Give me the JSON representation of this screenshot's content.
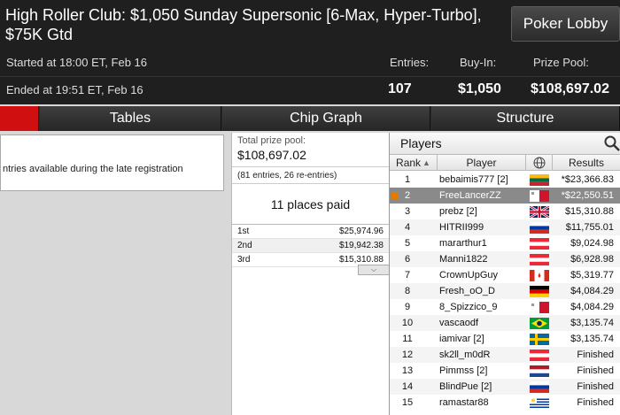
{
  "header": {
    "title": "High Roller Club: $1,050 Sunday Supersonic [6-Max, Hyper-Turbo], $75K Gtd",
    "lobby_button": "Poker Lobby",
    "started": "Started at 18:00 ET, Feb 16",
    "ended": "Ended at 19:51 ET, Feb 16",
    "entries_label": "Entries:",
    "entries_value": "107",
    "buyin_label": "Buy-In:",
    "buyin_value": "$1,050",
    "prize_label": "Prize Pool:",
    "prize_value": "$108,697.02"
  },
  "tabs": [
    "Tables",
    "Chip Graph",
    "Structure"
  ],
  "left_panel": {
    "note": "ntries available during the late registration"
  },
  "prize_panel": {
    "total_label": "Total prize pool:",
    "total_value": "$108,697.02",
    "entries_note": "(81 entries, 26 re-entries)",
    "places_paid": "11 places paid",
    "payouts": [
      {
        "place": "1st",
        "amount": "$25,974.96"
      },
      {
        "place": "2nd",
        "amount": "$19,942.38"
      },
      {
        "place": "3rd",
        "amount": "$15,310.88"
      }
    ]
  },
  "players": {
    "title": "Players",
    "columns": {
      "rank": "Rank",
      "player": "Player",
      "results": "Results"
    },
    "rows": [
      {
        "rank": "1",
        "name": "bebaimis777 [2]",
        "flag": "lithuania",
        "result": "*$23,366.83",
        "selected": false
      },
      {
        "rank": "2",
        "name": "FreeLancerZZ",
        "flag": "malta",
        "result": "*$22,550.51",
        "selected": true
      },
      {
        "rank": "3",
        "name": "prebz [2]",
        "flag": "uk",
        "result": "$15,310.88",
        "selected": false
      },
      {
        "rank": "4",
        "name": "HITRII999",
        "flag": "russia",
        "result": "$11,755.01",
        "selected": false
      },
      {
        "rank": "5",
        "name": "mararthur1",
        "flag": "austria",
        "result": "$9,024.98",
        "selected": false
      },
      {
        "rank": "6",
        "name": "Manni1822",
        "flag": "austria",
        "result": "$6,928.98",
        "selected": false
      },
      {
        "rank": "7",
        "name": "CrownUpGuy",
        "flag": "canada",
        "result": "$5,319.77",
        "selected": false
      },
      {
        "rank": "8",
        "name": "Fresh_oO_D",
        "flag": "germany",
        "result": "$4,084.29",
        "selected": false
      },
      {
        "rank": "9",
        "name": "8_Spizzico_9",
        "flag": "malta",
        "result": "$4,084.29",
        "selected": false
      },
      {
        "rank": "10",
        "name": "vascaodf",
        "flag": "brazil",
        "result": "$3,135.74",
        "selected": false
      },
      {
        "rank": "11",
        "name": "iamivar [2]",
        "flag": "sweden",
        "result": "$3,135.74",
        "selected": false
      },
      {
        "rank": "12",
        "name": "sk2ll_m0dR",
        "flag": "austria",
        "result": "Finished",
        "selected": false
      },
      {
        "rank": "13",
        "name": "Pimmss [2]",
        "flag": "netherlands",
        "result": "Finished",
        "selected": false
      },
      {
        "rank": "14",
        "name": "BlindPue [2]",
        "flag": "russia",
        "result": "Finished",
        "selected": false
      },
      {
        "rank": "15",
        "name": "ramastar88",
        "flag": "uruguay",
        "result": "Finished",
        "selected": false
      }
    ]
  },
  "colors": {
    "accent_red": "#d01010",
    "header_bg": "#1f1f1f",
    "selected_row": "#8a8a8a"
  }
}
